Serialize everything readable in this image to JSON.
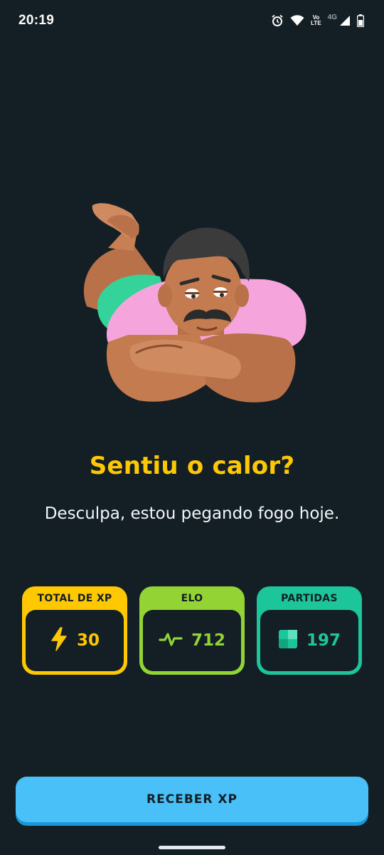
{
  "status_bar": {
    "time": "20:19",
    "volte_top": "Vo",
    "volte_bottom": "LTE",
    "network": "4G",
    "icons": [
      "alarm-icon",
      "wifi-icon",
      "volte-icon",
      "signal-icon",
      "battery-icon"
    ]
  },
  "illustration": {
    "icon": "character-lying-illustration"
  },
  "headline": "Sentiu o calor?",
  "subtitle": "Desculpa, estou pegando fogo hoje.",
  "stats": [
    {
      "title": "TOTAL DE XP",
      "value": "30",
      "icon": "lightning-icon",
      "color": "#ffc800"
    },
    {
      "title": "ELO",
      "value": "712",
      "icon": "pulse-icon",
      "color": "#93d333"
    },
    {
      "title": "PARTIDAS",
      "value": "197",
      "icon": "matches-square-icon",
      "color": "#1cc69a"
    }
  ],
  "button": {
    "label": "RECEBER XP",
    "color": "#49c0f8"
  },
  "colors": {
    "background": "#131f24",
    "headline": "#ffc800",
    "text": "#f1f7fb"
  }
}
